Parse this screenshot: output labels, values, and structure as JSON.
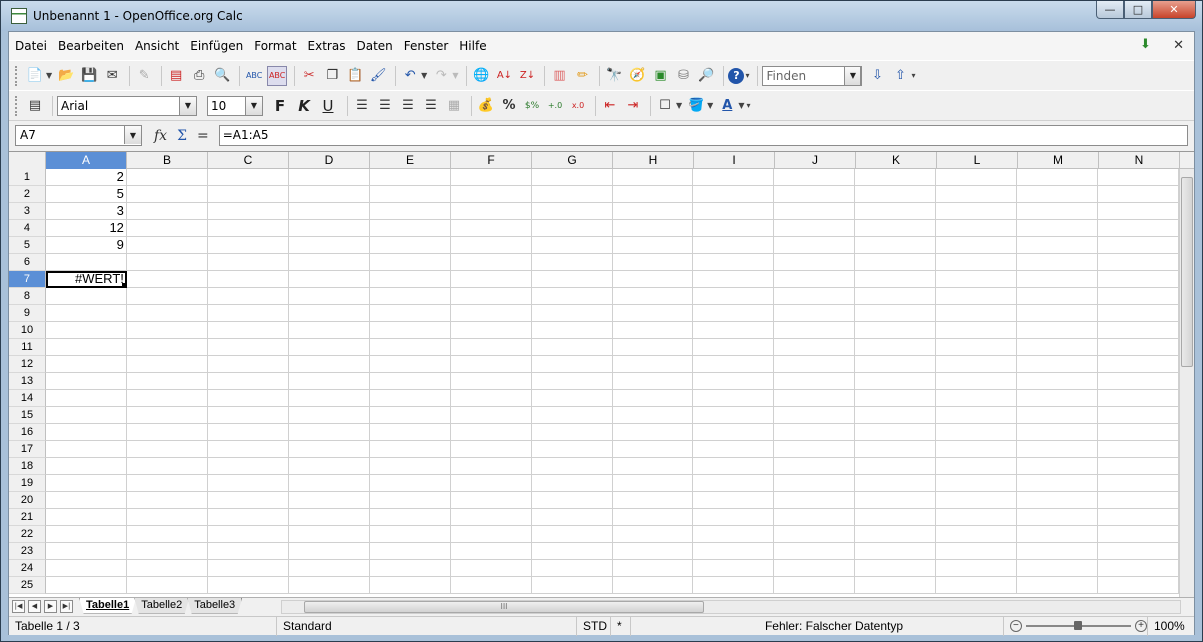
{
  "window": {
    "title": "Unbenannt 1 - OpenOffice.org Calc",
    "min_label": "—",
    "max_label": "□",
    "close_label": "✕"
  },
  "menu": [
    "Datei",
    "Bearbeiten",
    "Ansicht",
    "Einfügen",
    "Format",
    "Extras",
    "Daten",
    "Fenster",
    "Hilfe"
  ],
  "toolbar": {
    "find_placeholder": "Finden"
  },
  "format_toolbar": {
    "font": "Arial",
    "size": "10",
    "bold": "F",
    "italic": "K",
    "underline": "U"
  },
  "formula_bar": {
    "name_box": "A7",
    "fx": "fx",
    "sum": "Σ",
    "equals": "=",
    "formula": "=A1:A5"
  },
  "grid": {
    "columns": [
      "A",
      "B",
      "C",
      "D",
      "E",
      "F",
      "G",
      "H",
      "I",
      "J",
      "K",
      "L",
      "M",
      "N"
    ],
    "selected_column": "A",
    "rows": [
      "1",
      "2",
      "3",
      "4",
      "5",
      "6",
      "7",
      "8",
      "9",
      "10",
      "11",
      "12",
      "13",
      "14",
      "15",
      "16",
      "17",
      "18",
      "19",
      "20",
      "21",
      "22",
      "23",
      "24",
      "25"
    ],
    "selected_row": "7",
    "cells_A": [
      "2",
      "5",
      "3",
      "12",
      "9",
      "",
      "#WERT!"
    ]
  },
  "sheets": {
    "tabs": [
      "Tabelle1",
      "Tabelle2",
      "Tabelle3"
    ],
    "active": "Tabelle1",
    "hscroll_label": "III"
  },
  "status": {
    "sheet": "Tabelle 1 / 3",
    "style": "Standard",
    "mode": "STD",
    "modified": "*",
    "error": "Fehler: Falscher Datentyp",
    "zoom": "100%"
  }
}
